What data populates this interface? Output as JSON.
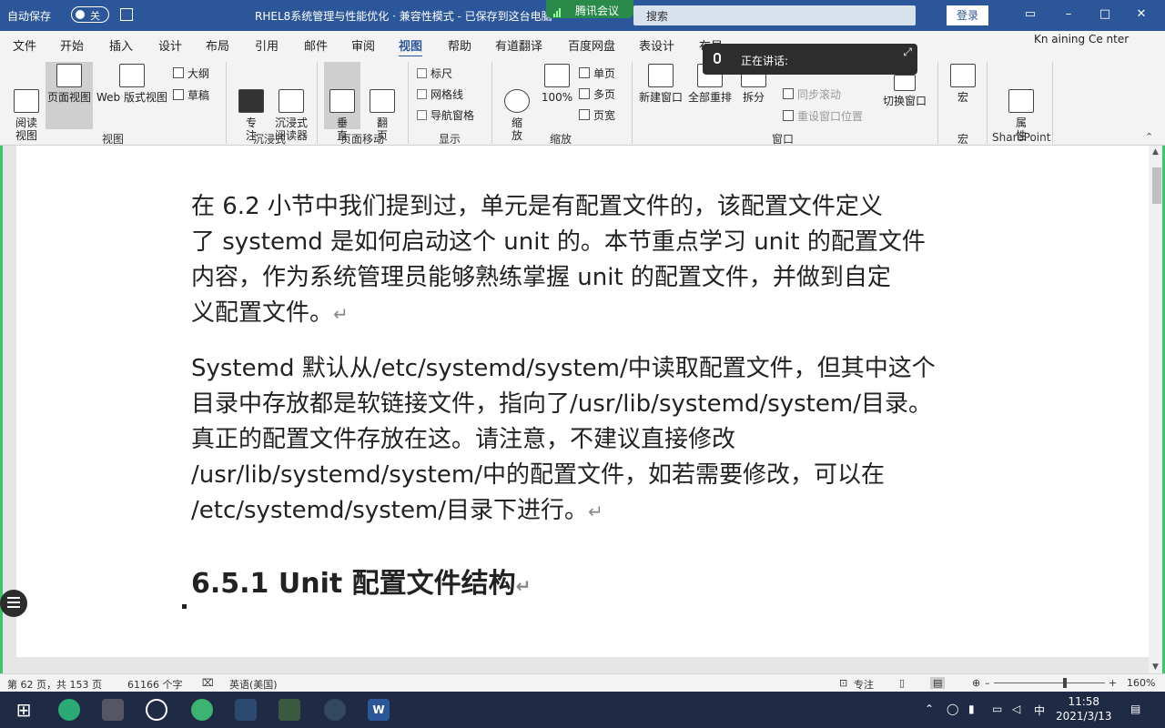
{
  "titlebar": {
    "autosave_label": "自动保存",
    "autosave_state": "关",
    "doc_title": "RHEL8系统管理与性能优化  ·  兼容性模式 - 已保存到这台电脑",
    "meeting_label": "腾讯会议",
    "search_placeholder": "搜索",
    "login_label": "登录",
    "accent": "#2b579a"
  },
  "menu": {
    "tabs": [
      "文件",
      "开始",
      "插入",
      "设计",
      "布局",
      "引用",
      "邮件",
      "审阅",
      "视图",
      "帮助",
      "有道翻译",
      "百度网盘",
      "表设计",
      "布局"
    ],
    "active": "视图"
  },
  "ribbon": {
    "views": {
      "read_mode": "阅读\n视图",
      "print_layout": "页面视图",
      "web_layout": "Web 版式视图",
      "outline": "大纲",
      "draft": "草稿",
      "group": "视图"
    },
    "immersive": {
      "focus": "专\n注",
      "immersive_reader": "沉浸式\n阅读器",
      "group": "沉浸式"
    },
    "page_movement": {
      "vertical": "垂\n直",
      "side_to_side": "翻\n页",
      "group": "页面移动"
    },
    "show": {
      "ruler": "标尺",
      "gridlines": "网格线",
      "nav_pane": "导航窗格",
      "group": "显示"
    },
    "zoom": {
      "zoom": "缩\n放",
      "zoom_100": "100%",
      "one_page": "单页",
      "multi_page": "多页",
      "page_width": "页宽",
      "group": "缩放"
    },
    "window": {
      "new_window": "新建窗口",
      "arrange_all": "全部重排",
      "split": "拆分",
      "sync_scroll": "同步滚动",
      "reset_pos": "重设窗口位置",
      "switch": "切换窗口",
      "group": "窗口"
    },
    "macros": {
      "label": "宏",
      "group": "宏"
    },
    "sharepoint": {
      "label": "属\n性",
      "group": "SharePoint"
    }
  },
  "overlay": {
    "speaking": "正在讲话:",
    "right_text": "Kn   aining Ce  nter"
  },
  "document": {
    "para1": [
      "在 6.2 小节中我们提到过，单元是有配置文件的，该配置文件定义",
      "了 systemd 是如何启动这个 unit 的。本节重点学习 unit 的配置文件",
      "内容，作为系统管理员能够熟练掌握 unit 的配置文件，并做到自定",
      "义配置文件。"
    ],
    "para2": [
      "Systemd 默认从/etc/systemd/system/中读取配置文件，但其中这个",
      "目录中存放都是软链接文件，指向了/usr/lib/systemd/system/目录。",
      "真正的配置文件存放在这。请注意，不建议直接修改",
      "/usr/lib/systemd/system/中的配置文件，如若需要修改，可以在",
      "/etc/systemd/system/目录下进行。"
    ],
    "para_mark": "↵",
    "heading": "6.5.1  Unit 配置文件结构"
  },
  "status": {
    "page": "第 62 页，共 153 页",
    "words": "61166 个字",
    "language": "英语(美国)",
    "focus": "专注",
    "zoom": "160%",
    "zoom_level": 0.6
  },
  "taskbar": {
    "time": "11:58",
    "date": "2021/3/13",
    "ime": "中"
  }
}
